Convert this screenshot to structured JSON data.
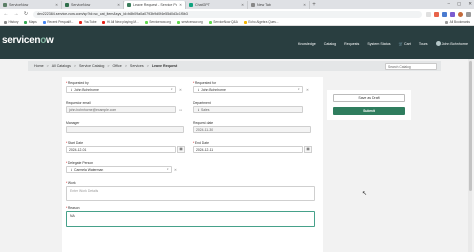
{
  "browser": {
    "tabs": [
      {
        "label": "ServiceNow",
        "color": "#5c7f67",
        "active": false
      },
      {
        "label": "ServiceNow",
        "color": "#2f6e4b",
        "active": false
      },
      {
        "label": "Leave Request - Service Portal",
        "color": "#3a7d5c",
        "active": true
      },
      {
        "label": "ChatGPT",
        "color": "#10a37f",
        "active": false
      },
      {
        "label": "New Tab",
        "color": "#888888",
        "active": false
      }
    ],
    "url": "dev222384.service-now.com/sp?id=sc_cat_item&sys_id=b8b09a0a0793b9d0f4e55d0d3c1f5b3",
    "bookmarks": [
      "History",
      "Maps",
      "Recent Prequalif...",
      "YouTube",
      "Hi All New playing M...",
      "Servicenow.org",
      "servicenow.org",
      "ServiceNow Q&A",
      "Echo Algebra Ques..."
    ],
    "all_bookmarks": "All Bookmarks"
  },
  "header": {
    "logo_pre": "servicen",
    "logo_o": "o",
    "logo_post": "w",
    "nav": [
      "Knowledge",
      "Catalog",
      "Requests",
      "System Status",
      "Cart",
      "Tours"
    ],
    "user": "John Bohnhorne"
  },
  "breadcrumb": {
    "items": [
      "Home",
      "All Catalogs",
      "Service Catalog",
      "Office",
      "Services",
      "Leave Request"
    ],
    "search_placeholder": "Search Catalog"
  },
  "form": {
    "requested_by": {
      "label": "Requested by",
      "value": "John Bohnhorne"
    },
    "requested_for": {
      "label": "Requested for",
      "value": "John Bohnhorne"
    },
    "requestor_email": {
      "label": "Requestor email",
      "value": "john.bohnhorne@example.com"
    },
    "department": {
      "label": "Department",
      "value": "Sales"
    },
    "manager": {
      "label": "Manager",
      "value": ""
    },
    "request_date": {
      "label": "Request date",
      "value": "2024-11-30"
    },
    "start_date": {
      "label": "Start Date",
      "value": "2024-12-01"
    },
    "end_date": {
      "label": "End Date",
      "value": "2024-12-11"
    },
    "delegate_person": {
      "label": "Delegate Person",
      "value": "Carmela Waterman"
    },
    "work": {
      "label": "Work",
      "placeholder": "Enter Work Details"
    },
    "reason": {
      "label": "Reason",
      "value": "NA",
      "counter": "NA"
    }
  },
  "panel": {
    "draft": "Save as Draft",
    "submit": "Submit"
  },
  "colors": {
    "header": "#293e40",
    "submit": "#2f7d5e",
    "focus": "#46a18a"
  }
}
